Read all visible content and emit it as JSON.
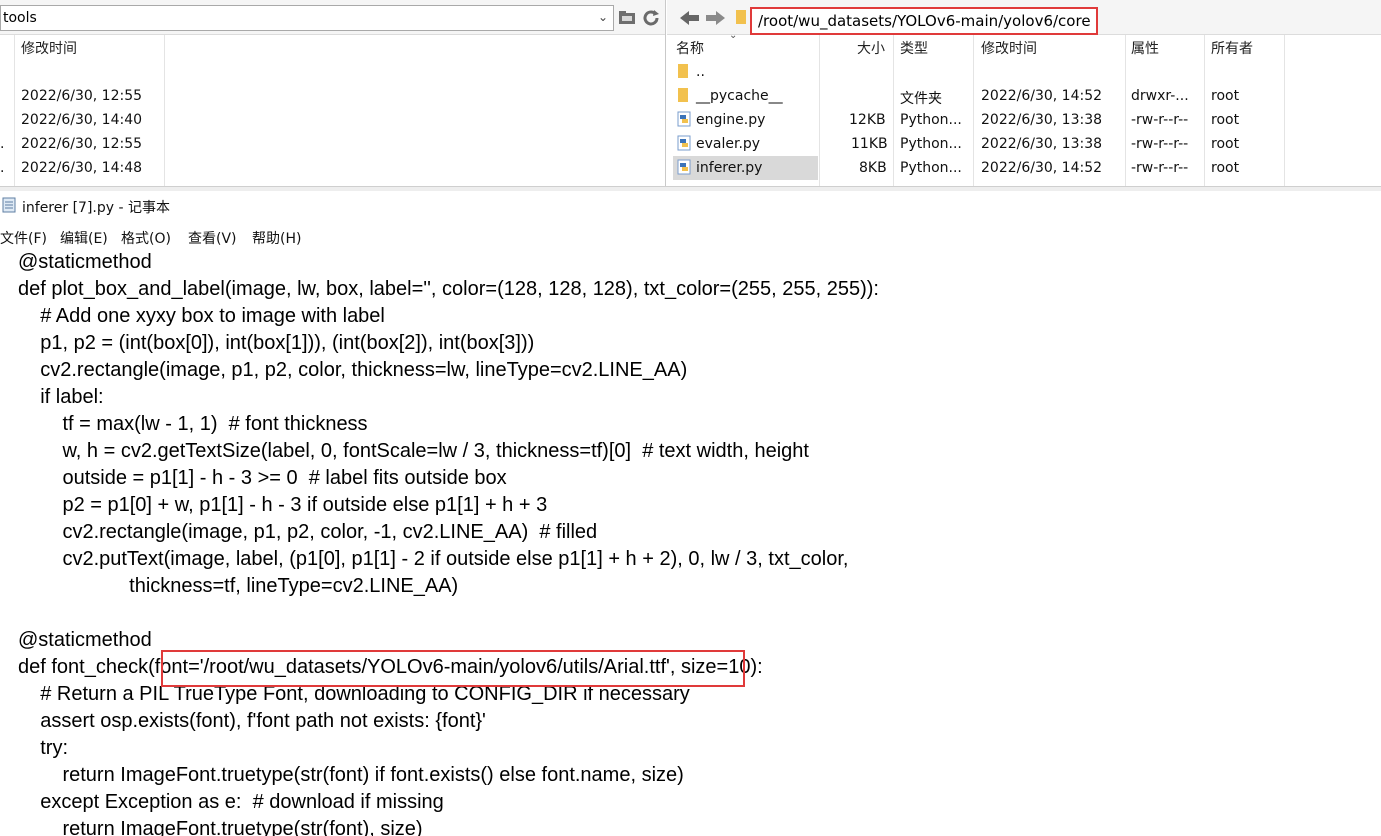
{
  "left_pane": {
    "path_value": "tools",
    "column_header": "修改时间",
    "rows": [
      {
        "marker": "",
        "modified": "2022/6/30, 12:55"
      },
      {
        "marker": "",
        "modified": "2022/6/30, 14:40"
      },
      {
        "marker": ".",
        "modified": "2022/6/30, 12:55"
      },
      {
        "marker": ".",
        "modified": "2022/6/30, 14:48"
      }
    ]
  },
  "right_pane": {
    "path_value": "/root/wu_datasets/YOLOv6-main/yolov6/core",
    "columns": {
      "name": "名称",
      "size": "大小",
      "type": "类型",
      "modified": "修改时间",
      "attr": "属性",
      "owner": "所有者"
    },
    "rows": [
      {
        "name": "..",
        "size": "",
        "type": "",
        "modified": "",
        "attr": "",
        "owner": "",
        "icon": "folder-icon"
      },
      {
        "name": "__pycache__",
        "size": "",
        "type": "文件夹",
        "modified": "2022/6/30, 14:52",
        "attr": "drwxr-...",
        "owner": "root",
        "icon": "folder-icon"
      },
      {
        "name": "engine.py",
        "size": "12KB",
        "type": "Python...",
        "modified": "2022/6/30, 13:38",
        "attr": "-rw-r--r--",
        "owner": "root",
        "icon": "python-file-icon"
      },
      {
        "name": "evaler.py",
        "size": "11KB",
        "type": "Python...",
        "modified": "2022/6/30, 13:38",
        "attr": "-rw-r--r--",
        "owner": "root",
        "icon": "python-file-icon"
      },
      {
        "name": "inferer.py",
        "size": "8KB",
        "type": "Python...",
        "modified": "2022/6/30, 14:52",
        "attr": "-rw-r--r--",
        "owner": "root",
        "icon": "python-file-icon",
        "selected": true
      }
    ]
  },
  "notepad": {
    "title": "inferer [7].py - 记事本",
    "menu": [
      "文件(F)",
      "编辑(E)",
      "格式(O)",
      "查看(V)",
      "帮助(H)"
    ],
    "code_lines": [
      "@staticmethod",
      "def plot_box_and_label(image, lw, box, label='', color=(128, 128, 128), txt_color=(255, 255, 255)):",
      "    # Add one xyxy box to image with label",
      "    p1, p2 = (int(box[0]), int(box[1])), (int(box[2]), int(box[3]))",
      "    cv2.rectangle(image, p1, p2, color, thickness=lw, lineType=cv2.LINE_AA)",
      "    if label:",
      "        tf = max(lw - 1, 1)  # font thickness",
      "        w, h = cv2.getTextSize(label, 0, fontScale=lw / 3, thickness=tf)[0]  # text width, height",
      "        outside = p1[1] - h - 3 >= 0  # label fits outside box",
      "        p2 = p1[0] + w, p1[1] - h - 3 if outside else p1[1] + h + 3",
      "        cv2.rectangle(image, p1, p2, color, -1, cv2.LINE_AA)  # filled",
      "        cv2.putText(image, label, (p1[0], p1[1] - 2 if outside else p1[1] + h + 2), 0, lw / 3, txt_color,",
      "                    thickness=tf, lineType=cv2.LINE_AA)",
      "",
      "@staticmethod",
      "def font_check(font='/root/wu_datasets/YOLOv6-main/yolov6/utils/Arial.ttf', size=10):",
      "    # Return a PIL TrueType Font, downloading to CONFIG_DIR if necessary",
      "    assert osp.exists(font), f'font path not exists: {font}'",
      "    try:",
      "        return ImageFont.truetype(str(font) if font.exists() else font.name, size)",
      "    except Exception as e:  # download if missing",
      "        return ImageFont.truetype(str(font), size)"
    ]
  },
  "colors": {
    "highlight_red": "#e03a3a",
    "selection_gray": "#d9d9d9"
  }
}
